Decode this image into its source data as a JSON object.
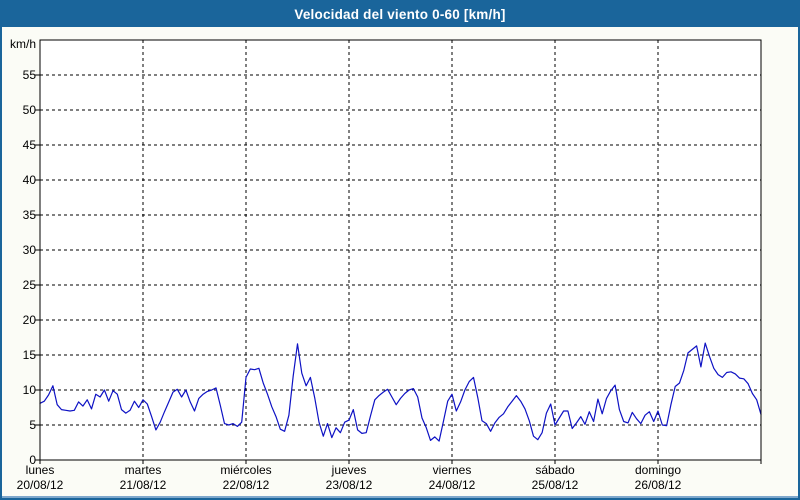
{
  "window": {
    "title": "Velocidad del viento 0-60 [km/h]"
  },
  "colors": {
    "titlebar_bg": "#1A659B",
    "title_text": "#FFFFFF",
    "window_border": "#1A659B",
    "bottom_accent": "#7FA8CC",
    "page_background": "#FBFCF6",
    "plot_background": "#FFFFFF",
    "grid": "#000000",
    "axis": "#000000",
    "tick_text": "#000000",
    "series_line": "#0E12C4"
  },
  "chart_data": {
    "type": "line",
    "title": "Velocidad del viento 0-60 [km/h]",
    "unit_label": "km/h",
    "ylabel": "km/h",
    "xlabel": "",
    "ylim": [
      0,
      60
    ],
    "ytick_step": 5,
    "yticks": [
      0,
      5,
      10,
      15,
      20,
      25,
      30,
      35,
      40,
      45,
      50,
      55
    ],
    "grid": "dashed horizontal at every 5 km/h and vertical at each day boundary",
    "legend": "none",
    "x_days": [
      {
        "name": "lunes",
        "date": "20/08/12"
      },
      {
        "name": "martes",
        "date": "21/08/12"
      },
      {
        "name": "miércoles",
        "date": "22/08/12"
      },
      {
        "name": "jueves",
        "date": "23/08/12"
      },
      {
        "name": "viernes",
        "date": "24/08/12"
      },
      {
        "name": "sábado",
        "date": "25/08/12"
      },
      {
        "name": "domingo",
        "date": "26/08/12"
      }
    ],
    "samples_per_day": 24,
    "series": [
      {
        "name": "Velocidad del viento",
        "values": [
          8.1,
          8.4,
          9.3,
          10.6,
          7.9,
          7.2,
          7.1,
          7.0,
          7.1,
          8.3,
          7.7,
          8.6,
          7.3,
          9.4,
          9.0,
          10.0,
          8.4,
          9.9,
          9.4,
          7.2,
          6.7,
          7.1,
          8.4,
          7.5,
          8.6,
          8.0,
          6.2,
          4.3,
          5.4,
          6.9,
          8.3,
          9.7,
          10.1,
          9.0,
          10.0,
          8.3,
          7.0,
          8.8,
          9.4,
          9.8,
          10.0,
          10.3,
          7.8,
          5.2,
          5.0,
          5.2,
          4.8,
          5.4,
          11.8,
          13.0,
          12.9,
          13.1,
          11.0,
          9.4,
          7.6,
          6.2,
          4.4,
          4.1,
          6.4,
          12.0,
          16.6,
          12.4,
          10.6,
          11.8,
          8.9,
          5.4,
          3.4,
          5.2,
          3.2,
          4.6,
          3.9,
          5.4,
          5.7,
          7.2,
          4.3,
          3.8,
          3.9,
          6.3,
          8.6,
          9.2,
          9.7,
          10.1,
          9.0,
          7.9,
          8.8,
          9.5,
          10.0,
          10.2,
          9.0,
          6.0,
          4.6,
          2.8,
          3.3,
          2.7,
          5.5,
          8.4,
          9.4,
          7.0,
          8.3,
          10.0,
          11.2,
          11.8,
          8.9,
          5.6,
          5.2,
          4.1,
          5.3,
          6.1,
          6.6,
          7.6,
          8.4,
          9.2,
          8.4,
          7.3,
          5.6,
          3.4,
          2.9,
          3.9,
          6.7,
          8.0,
          5.0,
          6.0,
          7.0,
          7.0,
          4.5,
          5.3,
          6.2,
          5.1,
          6.9,
          5.5,
          8.7,
          6.6,
          8.8,
          9.9,
          10.7,
          7.2,
          5.5,
          5.3,
          6.8,
          5.9,
          5.2,
          6.4,
          6.9,
          5.5,
          7.0,
          5.0,
          4.9,
          7.9,
          10.5,
          11.0,
          12.8,
          15.3,
          15.8,
          16.3,
          13.3,
          16.7,
          14.8,
          13.1,
          12.2,
          11.8,
          12.5,
          12.6,
          12.3,
          11.7,
          11.6,
          10.9,
          9.5,
          8.6,
          6.5
        ]
      }
    ]
  }
}
